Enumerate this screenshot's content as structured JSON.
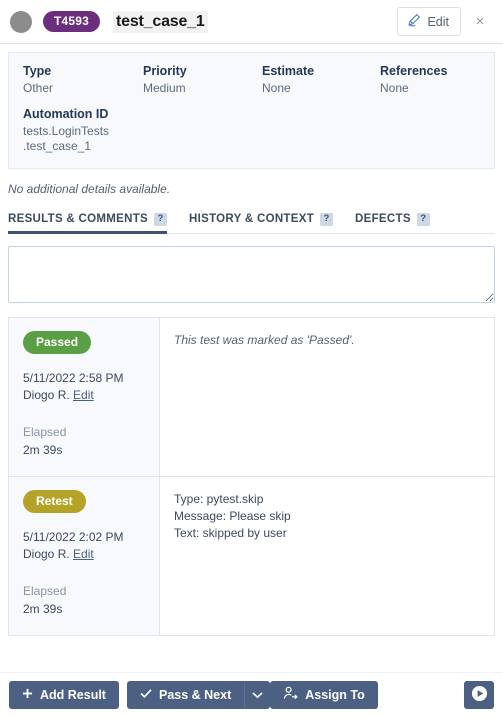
{
  "header": {
    "case_id": "T4593",
    "title": "test_case_1",
    "edit_label": "Edit",
    "close_label": "×"
  },
  "details": {
    "fields": [
      {
        "label": "Type",
        "value": "Other"
      },
      {
        "label": "Priority",
        "value": "Medium"
      },
      {
        "label": "Estimate",
        "value": "None"
      },
      {
        "label": "References",
        "value": "None"
      }
    ],
    "automation": {
      "label": "Automation ID",
      "line1": "tests.LoginTests",
      "line2": ".test_case_1"
    },
    "no_details_note": "No additional details available."
  },
  "tabs": [
    {
      "label": "RESULTS & COMMENTS",
      "help": "?",
      "active": true
    },
    {
      "label": "HISTORY & CONTEXT",
      "help": "?",
      "active": false
    },
    {
      "label": "DEFECTS",
      "help": "?",
      "active": false
    }
  ],
  "comment_box": {
    "value": "",
    "placeholder": ""
  },
  "results": [
    {
      "status": "Passed",
      "status_color": "#5a9e46",
      "date": "5/11/2022 2:58 PM",
      "author": "Diogo R.",
      "edit_link": "Edit",
      "elapsed_label": "Elapsed",
      "elapsed_value": "2m 39s",
      "message": "This test was marked as 'Passed'.",
      "message_italic": true,
      "detail_lines": []
    },
    {
      "status": "Retest",
      "status_color": "#b5a228",
      "date": "5/11/2022 2:02 PM",
      "author": "Diogo R.",
      "edit_link": "Edit",
      "elapsed_label": "Elapsed",
      "elapsed_value": "2m 39s",
      "message": "",
      "message_italic": false,
      "detail_lines": [
        "Type: pytest.skip",
        "Message: Please skip",
        "Text: skipped by user"
      ]
    }
  ],
  "footer": {
    "add_result_label": "Add Result",
    "pass_next_label": "Pass & Next",
    "assign_to_label": "Assign To"
  },
  "colors": {
    "case_badge": "#6b2d7e",
    "button": "#4b6082",
    "tab_active_underline": "#3d5170",
    "panel_bg": "#f7f9fc"
  }
}
